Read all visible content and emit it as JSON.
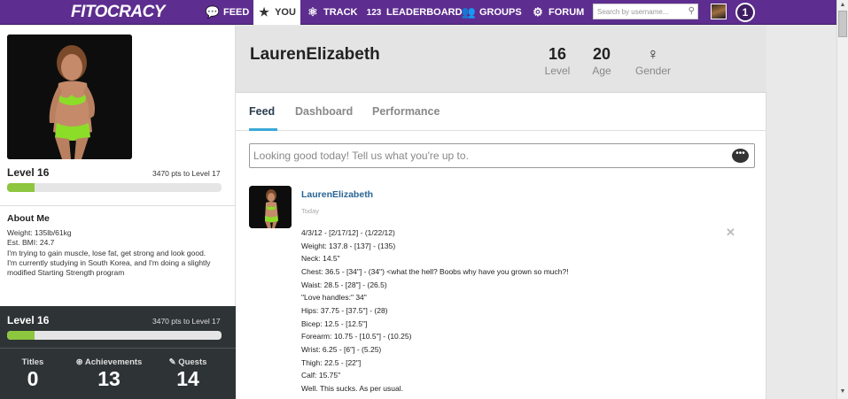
{
  "nav": {
    "logo": "FITOCRACY",
    "items": [
      {
        "label": "FEED",
        "icon": "chat-icon"
      },
      {
        "label": "YOU",
        "icon": "star-icon"
      },
      {
        "label": "TRACK",
        "icon": "atom-icon"
      },
      {
        "label": "LEADERBOARD",
        "icon": "123-icon"
      },
      {
        "label": "GROUPS",
        "icon": "people-icon"
      },
      {
        "label": "FORUM",
        "icon": "gear-icon"
      }
    ],
    "icon_glyphs": {
      "feed": "💬",
      "you": "★",
      "track": "⚛",
      "leaderboard": "123",
      "groups": "👥",
      "forum": "⚙"
    },
    "search_placeholder": "Search by username...",
    "notifications": "1"
  },
  "sidebar": {
    "level": "Level 16",
    "pts_to_next": "3470 pts to Level 17",
    "level_progress": 0.13,
    "about_title": "About Me",
    "about_lines": [
      "Weight: 135lb/61kg",
      "Est. BMI: 24.7",
      "I'm trying to gain muscle, lose fat, get strong and look good.",
      "I'm currently studying in South Korea, and I'm doing a slightly modified Starting Strength program"
    ],
    "dark": {
      "level": "Level 16",
      "pts_to_next": "3470 pts to Level 17",
      "level_progress": 0.13,
      "stats": [
        {
          "label": "Titles",
          "value": "0"
        },
        {
          "label": "⊛ Achievements",
          "value": "13"
        },
        {
          "label": "✎ Quests",
          "value": "14"
        }
      ]
    }
  },
  "profile": {
    "username": "LaurenElizabeth",
    "level_value": "16",
    "level_label": "Level",
    "age_value": "20",
    "age_label": "Age",
    "gender_symbol": "♀",
    "gender_label": "Gender"
  },
  "tabs": [
    "Feed",
    "Dashboard",
    "Performance"
  ],
  "post_box": {
    "placeholder": "Looking good today! Tell us what you're up to."
  },
  "feed_item": {
    "name": "LaurenElizabeth",
    "time": "Today",
    "lines": [
      "4/3/12 - [2/17/12] - (1/22/12)",
      "Weight: 137.8 - [137] - (135)",
      "Neck: 14.5\"",
      "Chest: 36.5 - [34\"] - (34\") <what the hell? Boobs why have you grown so much?!",
      "Waist: 28.5 - [28\"] - (26.5)",
      "\"Love handles:\" 34\"",
      "Hips: 37.75 - [37.5\"] - (28)",
      "Bicep: 12.5 - [12.5\"]",
      "Forearm: 10.75 - [10.5\"] - (10.25)",
      "Wrist: 6.25 - [6\"] - (5.25)",
      "Thigh: 22.5 - [22\"]",
      "Calf: 15.75\"",
      "Well. This sucks. As per usual."
    ]
  }
}
